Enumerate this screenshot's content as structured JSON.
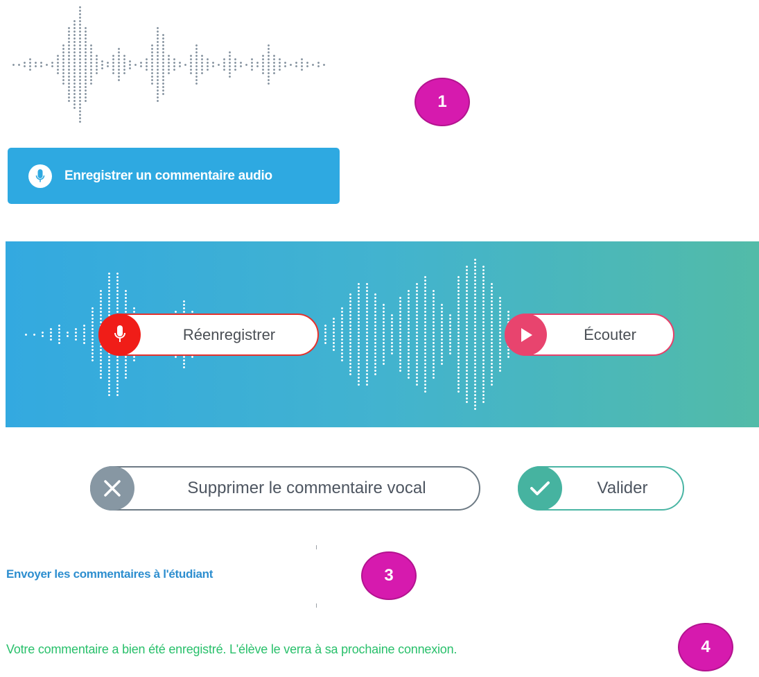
{
  "recorder": {
    "record_button_label": "Enregistrer un commentaire audio",
    "record_button_color": "#2ea9e1",
    "mic_icon": "microphone-icon"
  },
  "player": {
    "rerecord_label": "Réenregistrer",
    "listen_label": "Écouter",
    "rerecord_color": "#f01d18",
    "listen_color": "#e8446e",
    "panel_gradient": [
      "#33a9e0",
      "#52bba8"
    ]
  },
  "actions": {
    "delete_label": "Supprimer le commentaire vocal",
    "validate_label": "Valider",
    "delete_color": "#8797a3",
    "validate_color": "#46b3a0"
  },
  "send": {
    "link_label": "Envoyer les commentaires à l'étudiant"
  },
  "status": {
    "confirmation": "Votre commentaire a bien été enregistré. L'élève le verra à sa prochaine connexion.",
    "color": "#29c06b"
  },
  "badges": {
    "b1": "1",
    "b3": "3",
    "b4": "4",
    "color": "#d61aae"
  }
}
